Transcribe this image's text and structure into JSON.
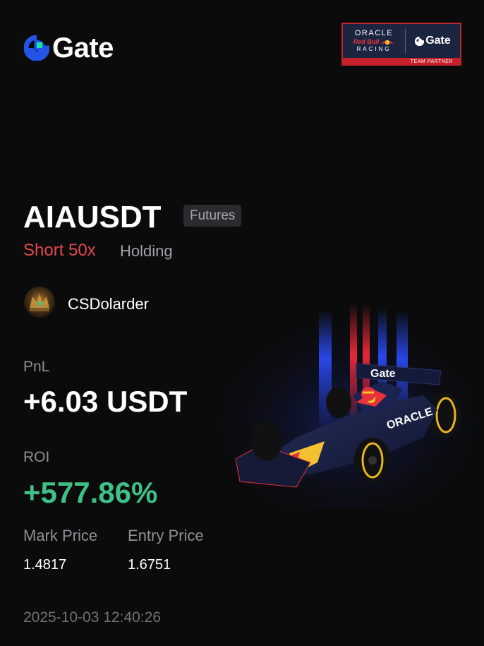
{
  "brand": {
    "name": "Gate",
    "accent_blue": "#2354e6",
    "accent_green": "#17e6a1"
  },
  "partner_badge": {
    "team_line1": "ORACLE",
    "team_line2": "Red Bull",
    "team_line3": "RACING",
    "brand": "Gate",
    "footer": "TEAM PARTNER"
  },
  "position": {
    "pair": "AIAUSDT",
    "market_tag": "Futures",
    "side": "Short 50x",
    "status": "Holding",
    "side_color": "#e5484d"
  },
  "user": {
    "username": "CSDolarder"
  },
  "stats": {
    "pnl_label": "PnL",
    "pnl_value": "+6.03 USDT",
    "roi_label": "ROI",
    "roi_value": "+577.86%",
    "roi_color": "#3ec187",
    "mark_price_label": "Mark Price",
    "mark_price_value": "1.4817",
    "entry_price_label": "Entry Price",
    "entry_price_value": "1.6751"
  },
  "timestamp": "2025-10-03 12:40:26",
  "illustration": {
    "car_wing_text": "Gate",
    "car_sidepod_text": "ORACLE"
  }
}
